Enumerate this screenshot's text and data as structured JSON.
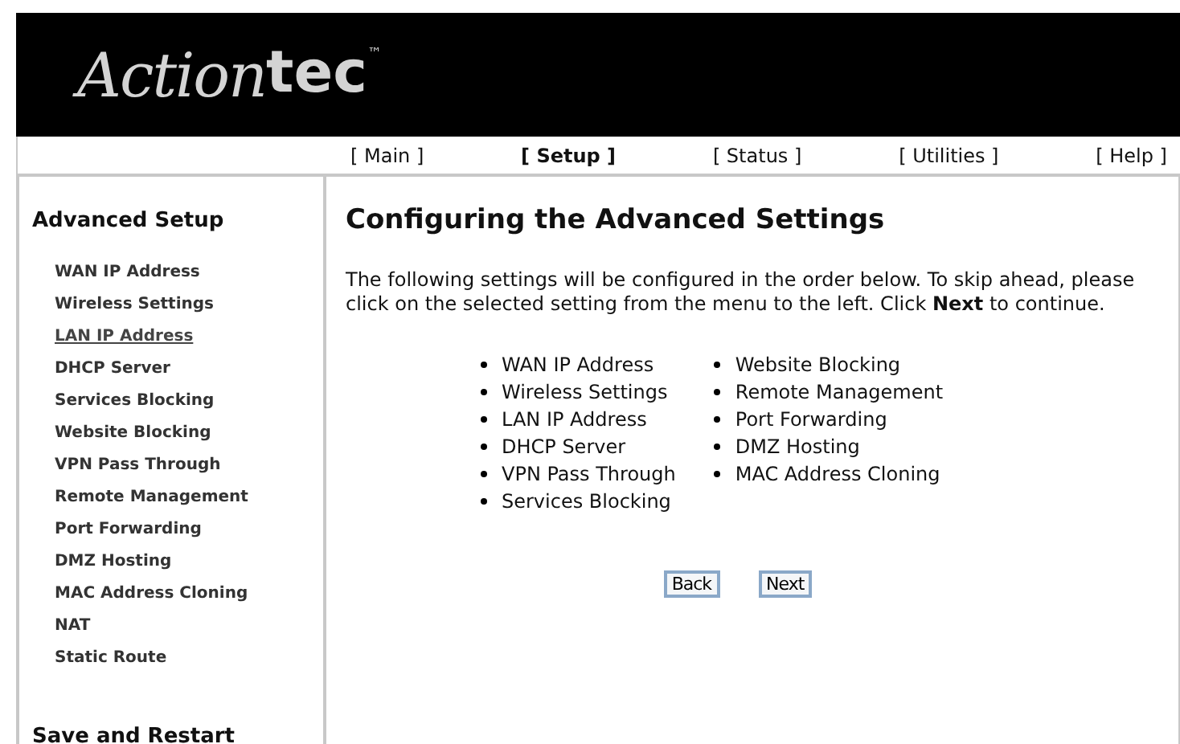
{
  "logo": {
    "script": "Action",
    "bold": "tec",
    "mark": "™"
  },
  "nav": [
    {
      "label": "[ Main ]",
      "selected": false
    },
    {
      "label": "[ Setup ]",
      "selected": true
    },
    {
      "label": "[ Status ]",
      "selected": false
    },
    {
      "label": "[ Utilities ]",
      "selected": false
    },
    {
      "label": "[ Help ]",
      "selected": false
    }
  ],
  "sidebar": {
    "title": "Advanced Setup",
    "items": [
      {
        "label": "WAN IP Address",
        "hovered": false
      },
      {
        "label": "Wireless Settings",
        "hovered": false
      },
      {
        "label": "LAN IP Address",
        "hovered": true
      },
      {
        "label": "DHCP Server",
        "hovered": false
      },
      {
        "label": "Services Blocking",
        "hovered": false
      },
      {
        "label": "Website Blocking",
        "hovered": false
      },
      {
        "label": "VPN Pass Through",
        "hovered": false
      },
      {
        "label": "Remote Management",
        "hovered": false
      },
      {
        "label": "Port Forwarding",
        "hovered": false
      },
      {
        "label": "DMZ Hosting",
        "hovered": false
      },
      {
        "label": "MAC Address Cloning",
        "hovered": false
      },
      {
        "label": "NAT",
        "hovered": false
      },
      {
        "label": "Static Route",
        "hovered": false
      }
    ],
    "footer_title": "Save and Restart"
  },
  "content": {
    "heading": "Configuring the Advanced Settings",
    "intro": "The following settings will be configured in the order below. To skip ahead, please click on the selected setting from the menu to the left. Click **Next** to continue.",
    "list_columns": [
      [
        "WAN IP Address",
        "Wireless Settings",
        "LAN IP Address",
        "DHCP Server",
        "VPN Pass Through",
        "Services Blocking"
      ],
      [
        "Website Blocking",
        "Remote Management",
        "Port Forwarding",
        "DMZ Hosting",
        "MAC Address Cloning"
      ]
    ],
    "buttons": [
      "Back",
      "Next"
    ]
  }
}
